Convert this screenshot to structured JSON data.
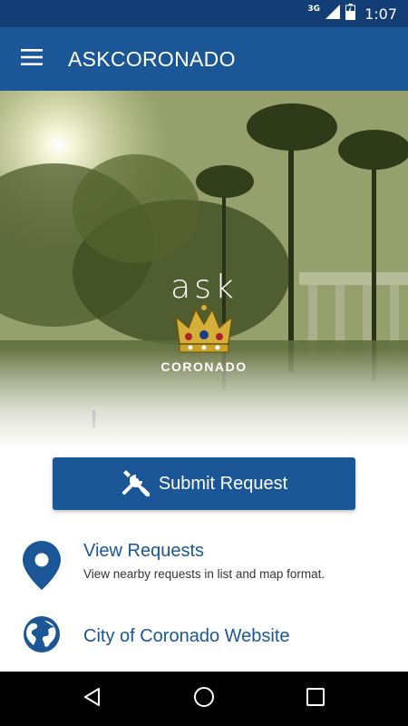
{
  "status_bar": {
    "network": "3G",
    "time": "1:07"
  },
  "app_bar": {
    "title": "ASKCORONADO"
  },
  "hero": {
    "logo_word": "ask",
    "logo_sub": "CORONADO"
  },
  "actions": {
    "submit_label": "Submit Request",
    "view_requests": {
      "title": "View Requests",
      "subtitle": "View nearby requests in list and map format."
    },
    "website": {
      "title": "City of Coronado Website"
    }
  },
  "colors": {
    "primary": "#1b5796",
    "status_bar": "#123e75",
    "nav_bar": "#000000"
  }
}
